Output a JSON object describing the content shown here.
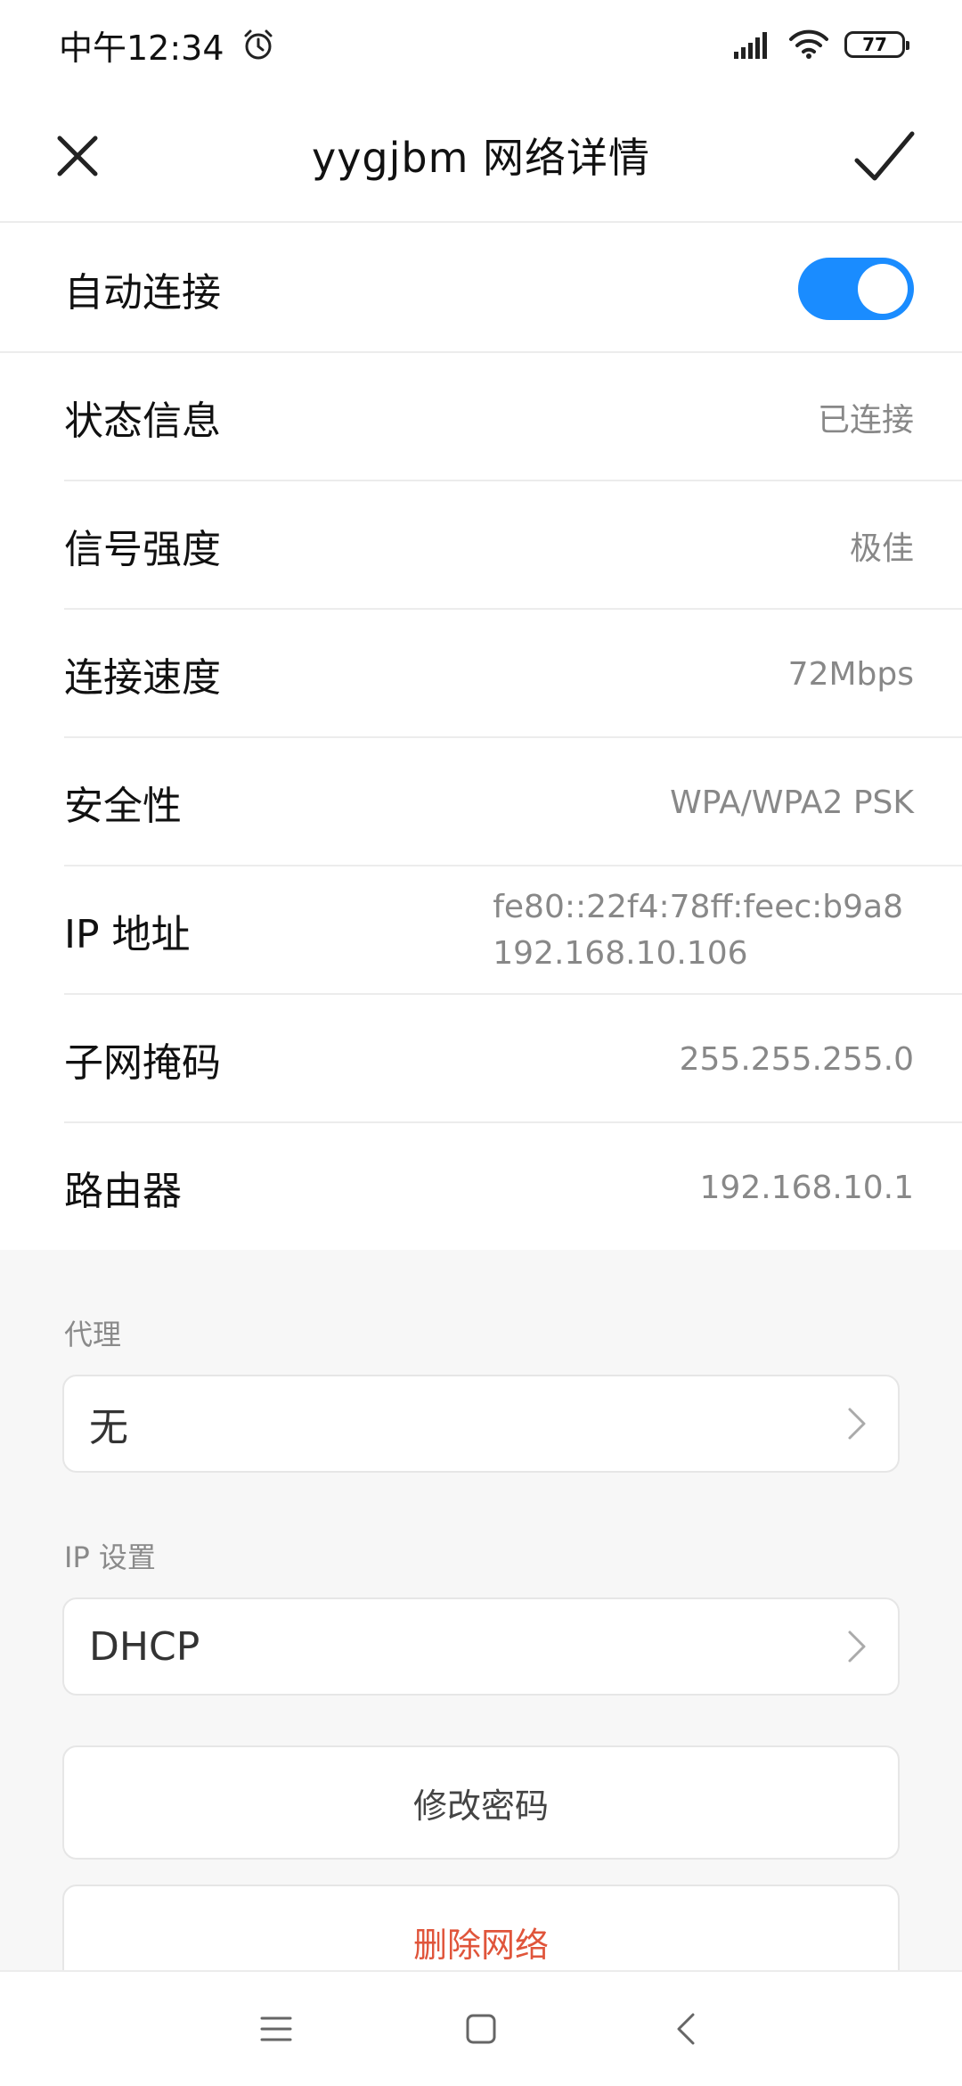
{
  "status_bar": {
    "time": "中午12:34",
    "battery": "77",
    "icons": [
      "alarm-icon",
      "signal-icon",
      "wifi-icon",
      "battery-icon"
    ]
  },
  "header": {
    "title": "yygjbm  网络详情",
    "close_icon": "close-icon",
    "confirm_icon": "check-icon"
  },
  "auto_connect": {
    "label": "自动连接",
    "enabled": true,
    "accent": "#1a8cff"
  },
  "details": [
    {
      "label": "状态信息",
      "value": "已连接"
    },
    {
      "label": "信号强度",
      "value": "极佳"
    },
    {
      "label": "连接速度",
      "value": "72Mbps"
    },
    {
      "label": "安全性",
      "value": "WPA/WPA2 PSK"
    },
    {
      "label": "IP 地址",
      "values": [
        "fe80::22f4:78ff:feec:b9a8",
        "192.168.10.106"
      ]
    },
    {
      "label": "子网掩码",
      "value": "255.255.255.0"
    },
    {
      "label": "路由器",
      "value": "192.168.10.1"
    }
  ],
  "proxy": {
    "label": "代理",
    "value": "无"
  },
  "ip_settings": {
    "label": "IP 设置",
    "value": "DHCP"
  },
  "buttons": {
    "change_password": "修改密码",
    "delete_network": "删除网络",
    "danger_color": "#e0553b"
  },
  "nav": {
    "icons": [
      "menu-icon",
      "home-icon",
      "back-icon"
    ]
  }
}
